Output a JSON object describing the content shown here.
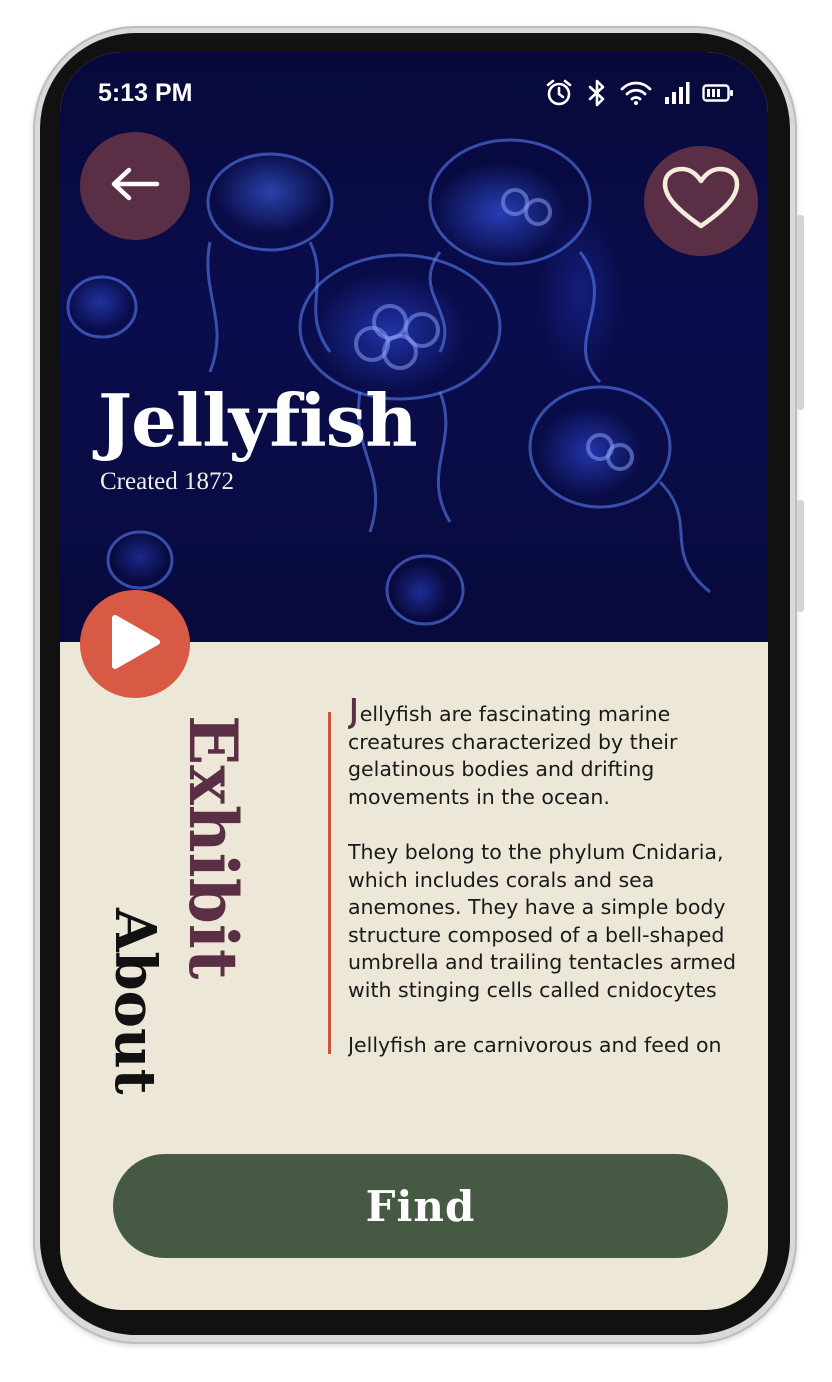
{
  "status_bar": {
    "time": "5:13 PM",
    "icons": [
      "alarm-icon",
      "bluetooth-icon",
      "wifi-icon",
      "signal-icon",
      "battery-icon"
    ]
  },
  "header": {
    "back_icon": "arrow-left-icon",
    "favorite_icon": "heart-icon"
  },
  "exhibit": {
    "title": "Jellyfish",
    "subtitle": "Created 1872"
  },
  "media": {
    "play_icon": "play-icon"
  },
  "labels": {
    "exhibit": "Exhibit",
    "about": "About"
  },
  "description": {
    "drop_cap": "J",
    "para1_rest": "ellyfish are fascinating marine creatures characterized by their gelatinous bodies and drifting movements in the ocean.",
    "para2": "They belong to the phylum Cnidaria, which includes corals and sea anemones. They have a simple body structure composed of a bell-shaped umbrella and trailing tentacles armed with stinging cells called cnidocytes",
    "para3": "Jellyfish are carnivorous and feed on"
  },
  "actions": {
    "find_label": "Find"
  },
  "colors": {
    "plum": "#5a2f45",
    "coral": "#d85a45",
    "green": "#465a43",
    "cream": "#ece7d7",
    "navy": "#0a0d4d"
  }
}
